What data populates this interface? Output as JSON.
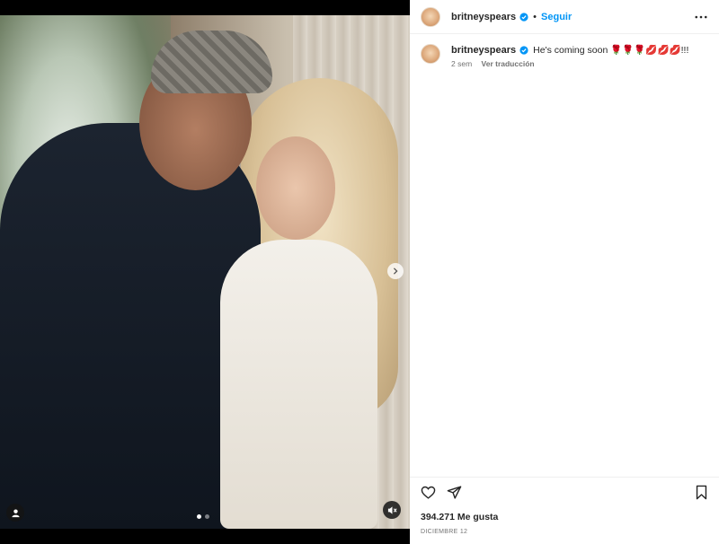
{
  "post": {
    "username": "britneyspears",
    "follow_label": "Seguir",
    "separator": "•",
    "caption_text": "He's coming soon 🌹🌹🌹💋💋💋!!!",
    "time_ago": "2 sem",
    "translate_label": "Ver traducción",
    "likes_text": "394.271 Me gusta",
    "date_text": "DICIEMBRE 12"
  },
  "media": {
    "carousel": {
      "total": 2,
      "current": 1
    }
  },
  "icons": {
    "verified": "verified-badge-icon",
    "more": "more-options-icon",
    "next": "chevron-right-icon",
    "tag": "user-tag-icon",
    "mute": "volume-off-icon",
    "like": "heart-icon",
    "share": "paper-plane-icon",
    "save": "bookmark-icon"
  },
  "colors": {
    "accent": "#0095f6",
    "text": "#262626",
    "secondary": "#737373"
  }
}
